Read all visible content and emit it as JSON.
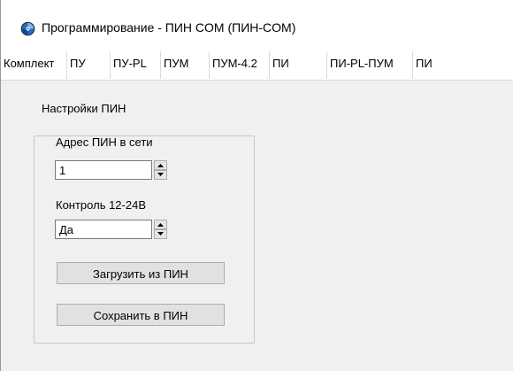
{
  "window": {
    "title": "Программирование - ПИН COM (ПИН-COM)",
    "icon": "app-disc-icon"
  },
  "tabs": [
    {
      "label": "Комплект"
    },
    {
      "label": "ПУ"
    },
    {
      "label": "ПУ-PL"
    },
    {
      "label": "ПУМ"
    },
    {
      "label": "ПУМ-4.2"
    },
    {
      "label": "ПИ"
    },
    {
      "label": "ПИ-PL-ПУМ"
    },
    {
      "label": "ПИ"
    }
  ],
  "settings": {
    "group_title": "Настройки ПИН",
    "address_label": "Адрес ПИН в сети",
    "address_value": "1",
    "control_label": "Контроль 12-24В",
    "control_value": "Да",
    "load_button": "Загрузить из ПИН",
    "save_button": "Сохранить в ПИН"
  },
  "colors": {
    "panel_background": "#f0f0f0",
    "button_face": "#e1e1e1",
    "icon_blue": "#1f6fd1"
  }
}
